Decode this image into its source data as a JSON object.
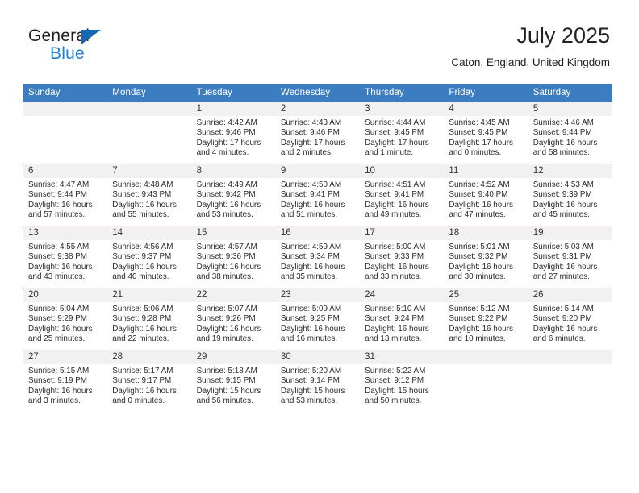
{
  "brand": {
    "name_top": "General",
    "name_bottom": "Blue",
    "accent_color": "#1668b3",
    "blue_text_color": "#1f7fd0"
  },
  "header": {
    "title": "July 2025",
    "subtitle": "Caton, England, United Kingdom"
  },
  "theme": {
    "header_row_bg": "#3b7dc0",
    "header_row_text": "#ffffff",
    "daynum_band_bg": "#f1f1f1",
    "cell_border": "#3b7dc0"
  },
  "weekdays": [
    "Sunday",
    "Monday",
    "Tuesday",
    "Wednesday",
    "Thursday",
    "Friday",
    "Saturday"
  ],
  "weeks": [
    [
      {
        "day": "",
        "empty": true
      },
      {
        "day": "",
        "empty": true
      },
      {
        "day": "1",
        "sunrise": "Sunrise: 4:42 AM",
        "sunset": "Sunset: 9:46 PM",
        "daylight": "Daylight: 17 hours and 4 minutes."
      },
      {
        "day": "2",
        "sunrise": "Sunrise: 4:43 AM",
        "sunset": "Sunset: 9:46 PM",
        "daylight": "Daylight: 17 hours and 2 minutes."
      },
      {
        "day": "3",
        "sunrise": "Sunrise: 4:44 AM",
        "sunset": "Sunset: 9:45 PM",
        "daylight": "Daylight: 17 hours and 1 minute."
      },
      {
        "day": "4",
        "sunrise": "Sunrise: 4:45 AM",
        "sunset": "Sunset: 9:45 PM",
        "daylight": "Daylight: 17 hours and 0 minutes."
      },
      {
        "day": "5",
        "sunrise": "Sunrise: 4:46 AM",
        "sunset": "Sunset: 9:44 PM",
        "daylight": "Daylight: 16 hours and 58 minutes."
      }
    ],
    [
      {
        "day": "6",
        "sunrise": "Sunrise: 4:47 AM",
        "sunset": "Sunset: 9:44 PM",
        "daylight": "Daylight: 16 hours and 57 minutes."
      },
      {
        "day": "7",
        "sunrise": "Sunrise: 4:48 AM",
        "sunset": "Sunset: 9:43 PM",
        "daylight": "Daylight: 16 hours and 55 minutes."
      },
      {
        "day": "8",
        "sunrise": "Sunrise: 4:49 AM",
        "sunset": "Sunset: 9:42 PM",
        "daylight": "Daylight: 16 hours and 53 minutes."
      },
      {
        "day": "9",
        "sunrise": "Sunrise: 4:50 AM",
        "sunset": "Sunset: 9:41 PM",
        "daylight": "Daylight: 16 hours and 51 minutes."
      },
      {
        "day": "10",
        "sunrise": "Sunrise: 4:51 AM",
        "sunset": "Sunset: 9:41 PM",
        "daylight": "Daylight: 16 hours and 49 minutes."
      },
      {
        "day": "11",
        "sunrise": "Sunrise: 4:52 AM",
        "sunset": "Sunset: 9:40 PM",
        "daylight": "Daylight: 16 hours and 47 minutes."
      },
      {
        "day": "12",
        "sunrise": "Sunrise: 4:53 AM",
        "sunset": "Sunset: 9:39 PM",
        "daylight": "Daylight: 16 hours and 45 minutes."
      }
    ],
    [
      {
        "day": "13",
        "sunrise": "Sunrise: 4:55 AM",
        "sunset": "Sunset: 9:38 PM",
        "daylight": "Daylight: 16 hours and 43 minutes."
      },
      {
        "day": "14",
        "sunrise": "Sunrise: 4:56 AM",
        "sunset": "Sunset: 9:37 PM",
        "daylight": "Daylight: 16 hours and 40 minutes."
      },
      {
        "day": "15",
        "sunrise": "Sunrise: 4:57 AM",
        "sunset": "Sunset: 9:36 PM",
        "daylight": "Daylight: 16 hours and 38 minutes."
      },
      {
        "day": "16",
        "sunrise": "Sunrise: 4:59 AM",
        "sunset": "Sunset: 9:34 PM",
        "daylight": "Daylight: 16 hours and 35 minutes."
      },
      {
        "day": "17",
        "sunrise": "Sunrise: 5:00 AM",
        "sunset": "Sunset: 9:33 PM",
        "daylight": "Daylight: 16 hours and 33 minutes."
      },
      {
        "day": "18",
        "sunrise": "Sunrise: 5:01 AM",
        "sunset": "Sunset: 9:32 PM",
        "daylight": "Daylight: 16 hours and 30 minutes."
      },
      {
        "day": "19",
        "sunrise": "Sunrise: 5:03 AM",
        "sunset": "Sunset: 9:31 PM",
        "daylight": "Daylight: 16 hours and 27 minutes."
      }
    ],
    [
      {
        "day": "20",
        "sunrise": "Sunrise: 5:04 AM",
        "sunset": "Sunset: 9:29 PM",
        "daylight": "Daylight: 16 hours and 25 minutes."
      },
      {
        "day": "21",
        "sunrise": "Sunrise: 5:06 AM",
        "sunset": "Sunset: 9:28 PM",
        "daylight": "Daylight: 16 hours and 22 minutes."
      },
      {
        "day": "22",
        "sunrise": "Sunrise: 5:07 AM",
        "sunset": "Sunset: 9:26 PM",
        "daylight": "Daylight: 16 hours and 19 minutes."
      },
      {
        "day": "23",
        "sunrise": "Sunrise: 5:09 AM",
        "sunset": "Sunset: 9:25 PM",
        "daylight": "Daylight: 16 hours and 16 minutes."
      },
      {
        "day": "24",
        "sunrise": "Sunrise: 5:10 AM",
        "sunset": "Sunset: 9:24 PM",
        "daylight": "Daylight: 16 hours and 13 minutes."
      },
      {
        "day": "25",
        "sunrise": "Sunrise: 5:12 AM",
        "sunset": "Sunset: 9:22 PM",
        "daylight": "Daylight: 16 hours and 10 minutes."
      },
      {
        "day": "26",
        "sunrise": "Sunrise: 5:14 AM",
        "sunset": "Sunset: 9:20 PM",
        "daylight": "Daylight: 16 hours and 6 minutes."
      }
    ],
    [
      {
        "day": "27",
        "sunrise": "Sunrise: 5:15 AM",
        "sunset": "Sunset: 9:19 PM",
        "daylight": "Daylight: 16 hours and 3 minutes."
      },
      {
        "day": "28",
        "sunrise": "Sunrise: 5:17 AM",
        "sunset": "Sunset: 9:17 PM",
        "daylight": "Daylight: 16 hours and 0 minutes."
      },
      {
        "day": "29",
        "sunrise": "Sunrise: 5:18 AM",
        "sunset": "Sunset: 9:15 PM",
        "daylight": "Daylight: 15 hours and 56 minutes."
      },
      {
        "day": "30",
        "sunrise": "Sunrise: 5:20 AM",
        "sunset": "Sunset: 9:14 PM",
        "daylight": "Daylight: 15 hours and 53 minutes."
      },
      {
        "day": "31",
        "sunrise": "Sunrise: 5:22 AM",
        "sunset": "Sunset: 9:12 PM",
        "daylight": "Daylight: 15 hours and 50 minutes."
      },
      {
        "day": "",
        "empty": true
      },
      {
        "day": "",
        "empty": true
      }
    ]
  ]
}
